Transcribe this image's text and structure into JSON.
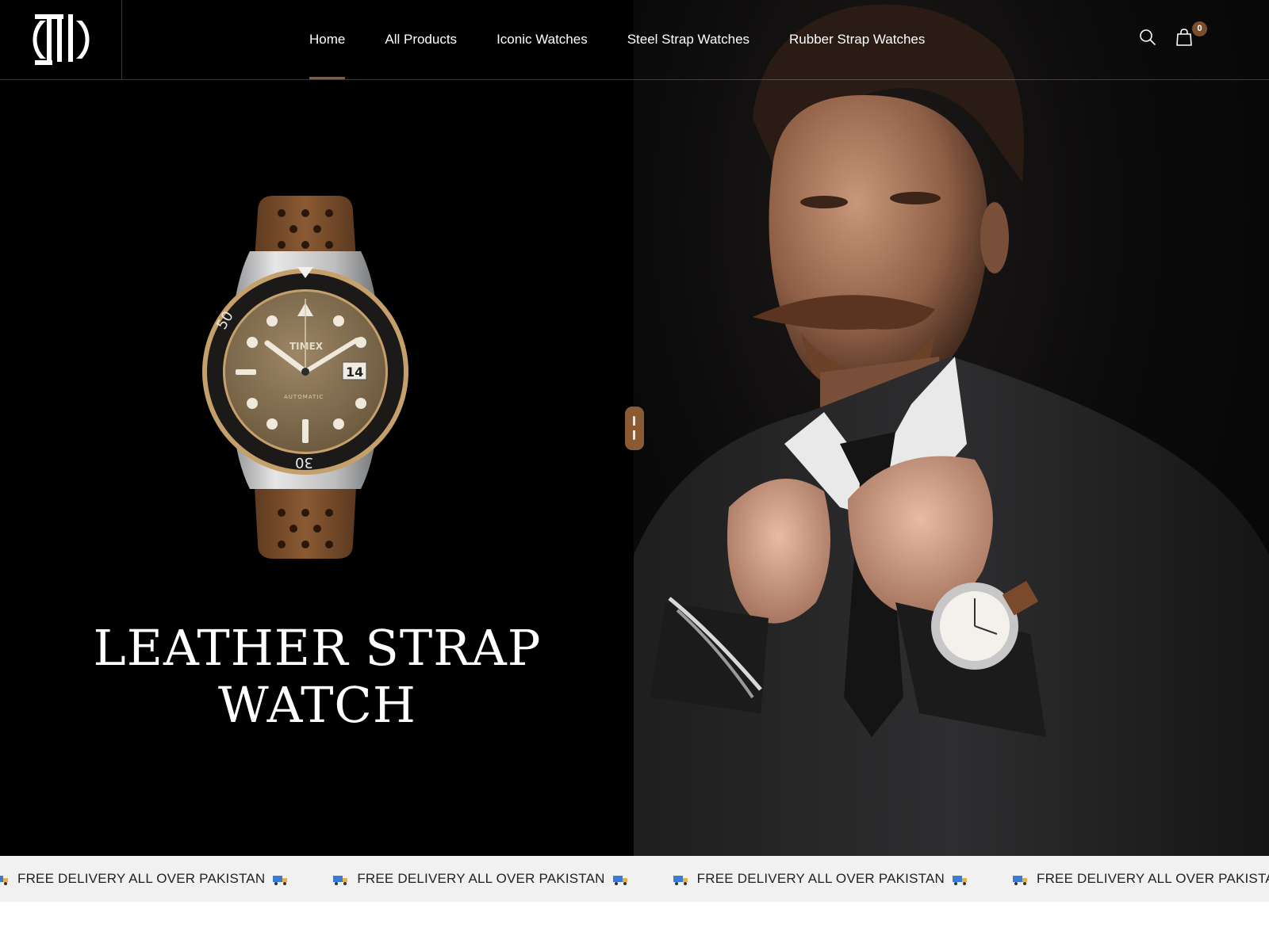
{
  "header": {
    "logo_alt": "IW",
    "nav": [
      {
        "label": "Home",
        "active": true
      },
      {
        "label": "All Products",
        "active": false
      },
      {
        "label": "Iconic Watches",
        "active": false
      },
      {
        "label": "Steel Strap Watches",
        "active": false
      },
      {
        "label": "Rubber Strap Watches",
        "active": false
      }
    ],
    "cart_count": "0",
    "icons": {
      "search": "search-icon",
      "cart": "shopping-bag-icon"
    }
  },
  "hero": {
    "title_line1": "LEATHER STRAP",
    "title_line2": "WATCH",
    "watch_brand": "TIMEX",
    "watch_date": "14",
    "watch_subtext": "AUTOMATIC"
  },
  "marquee": {
    "text": "FREE DELIVERY ALL OVER PAKISTAN",
    "icon": "truck-emoji-icon"
  },
  "colors": {
    "accent": "#8a5a33",
    "hero_bg": "#000000",
    "marquee_bg": "#f1f1f1"
  }
}
